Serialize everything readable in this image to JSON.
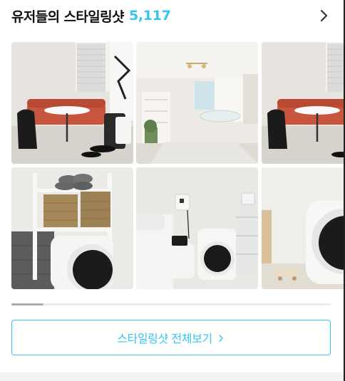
{
  "header": {
    "title": "유저들의 스타일링샷",
    "count": "5,117"
  },
  "photos": [
    {
      "subject": "red sofa, round table, dryer"
    },
    {
      "subject": "white living room"
    },
    {
      "subject": "red sofa, round table, dryer"
    },
    {
      "subject": "baskets on dryer shelf"
    },
    {
      "subject": "bedroom with dryer"
    },
    {
      "subject": "dryer close-up"
    }
  ],
  "carousel": {
    "progress": 0.1
  },
  "cta": {
    "label": "스타일링샷 전체보기"
  },
  "colors": {
    "accent": "#35c5f0",
    "track": "#eaedef",
    "thumb": "#a4acb3"
  },
  "icons": {
    "header_more": "chevron-right-icon",
    "cta_more": "chevron-right-icon"
  }
}
